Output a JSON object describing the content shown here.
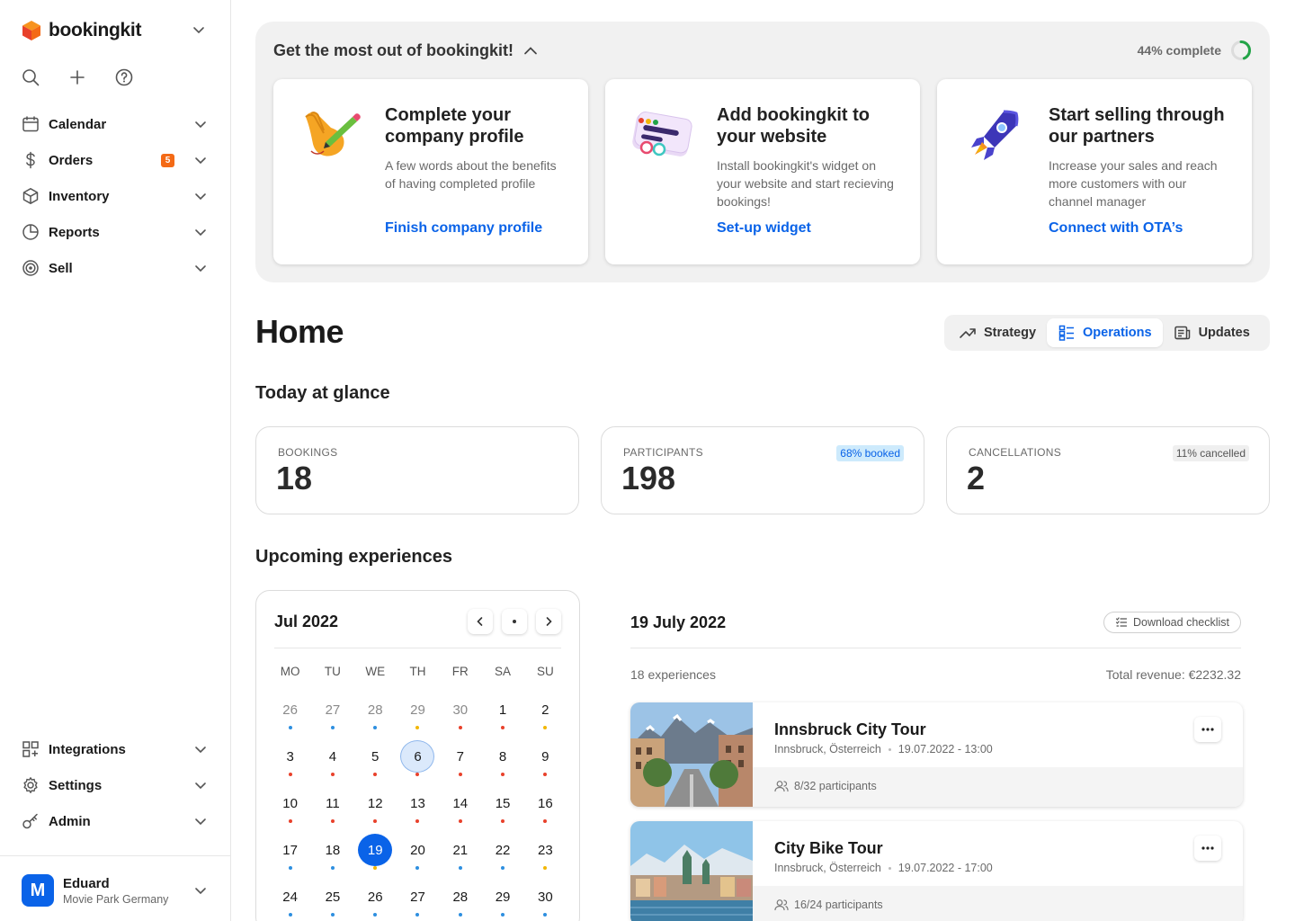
{
  "brand": {
    "name": "bookingkit"
  },
  "sidebar": {
    "items": [
      {
        "label": "Calendar",
        "icon": "calendar-icon"
      },
      {
        "label": "Orders",
        "icon": "dollar-icon",
        "badge": "5"
      },
      {
        "label": "Inventory",
        "icon": "box-icon"
      },
      {
        "label": "Reports",
        "icon": "pie-chart-icon"
      },
      {
        "label": "Sell",
        "icon": "target-icon"
      }
    ],
    "bottom_items": [
      {
        "label": "Integrations",
        "icon": "grid-plus-icon"
      },
      {
        "label": "Settings",
        "icon": "gear-icon"
      },
      {
        "label": "Admin",
        "icon": "key-icon"
      }
    ]
  },
  "user": {
    "initial": "M",
    "name": "Eduard",
    "org": "Movie Park Germany"
  },
  "onboarding": {
    "title": "Get the most out of bookingkit!",
    "progress_label": "44% complete",
    "progress": 0.44,
    "cards": [
      {
        "title": "Complete your company profile",
        "desc": "A few words about the benefits of having completed profile",
        "link": "Finish company profile"
      },
      {
        "title": "Add bookingkit to your website",
        "desc": "Install bookingkit's widget on your website and start recieving bookings!",
        "link": "Set-up widget"
      },
      {
        "title": "Start selling through our partners",
        "desc": "Increase your sales and reach more customers with our channel manager",
        "link": "Connect with OTA’s"
      }
    ]
  },
  "home": {
    "title": "Home",
    "tabs": [
      {
        "label": "Strategy",
        "active": false
      },
      {
        "label": "Operations",
        "active": true
      },
      {
        "label": "Updates",
        "active": false
      }
    ]
  },
  "glance": {
    "title": "Today at glance",
    "stats": [
      {
        "label": "BOOKINGS",
        "value": "18",
        "tag": ""
      },
      {
        "label": "PARTICIPANTS",
        "value": "198",
        "tag": "68% booked"
      },
      {
        "label": "CANCELLATIONS",
        "value": "2",
        "tag": "11% cancelled"
      }
    ]
  },
  "upcoming": {
    "title": "Upcoming experiences",
    "calendar": {
      "month": "Jul 2022",
      "weekdays": [
        "MO",
        "TU",
        "WE",
        "TH",
        "FR",
        "SA",
        "SU"
      ],
      "days": [
        {
          "n": "26",
          "muted": true,
          "dot": "#2d8fe0"
        },
        {
          "n": "27",
          "muted": true,
          "dot": "#2d8fe0"
        },
        {
          "n": "28",
          "muted": true,
          "dot": "#2d8fe0"
        },
        {
          "n": "29",
          "muted": true,
          "dot": "#f2b705"
        },
        {
          "n": "30",
          "muted": true,
          "dot": "#e8412b"
        },
        {
          "n": "1",
          "dot": "#e8412b"
        },
        {
          "n": "2",
          "dot": "#f2b705"
        },
        {
          "n": "3",
          "dot": "#e8412b"
        },
        {
          "n": "4",
          "dot": "#e8412b"
        },
        {
          "n": "5",
          "dot": "#e8412b"
        },
        {
          "n": "6",
          "dot": "#e8412b",
          "state": "sel-light"
        },
        {
          "n": "7",
          "dot": "#e8412b"
        },
        {
          "n": "8",
          "dot": "#e8412b"
        },
        {
          "n": "9",
          "dot": "#e8412b"
        },
        {
          "n": "10",
          "dot": "#e8412b"
        },
        {
          "n": "11",
          "dot": "#e8412b"
        },
        {
          "n": "12",
          "dot": "#e8412b"
        },
        {
          "n": "13",
          "dot": "#e8412b"
        },
        {
          "n": "14",
          "dot": "#e8412b"
        },
        {
          "n": "15",
          "dot": "#e8412b"
        },
        {
          "n": "16",
          "dot": "#e8412b"
        },
        {
          "n": "17",
          "dot": "#2d8fe0"
        },
        {
          "n": "18",
          "dot": "#2d8fe0"
        },
        {
          "n": "19",
          "dot": "#f2b705",
          "state": "sel"
        },
        {
          "n": "20",
          "dot": "#2d8fe0"
        },
        {
          "n": "21",
          "dot": "#2d8fe0"
        },
        {
          "n": "22",
          "dot": "#2d8fe0"
        },
        {
          "n": "23",
          "dot": "#f2b705"
        },
        {
          "n": "24",
          "dot": "#2d8fe0"
        },
        {
          "n": "25",
          "dot": "#2d8fe0"
        },
        {
          "n": "26",
          "dot": "#2d8fe0"
        },
        {
          "n": "27",
          "dot": "#2d8fe0"
        },
        {
          "n": "28",
          "dot": "#2d8fe0"
        },
        {
          "n": "29",
          "dot": "#2d8fe0"
        },
        {
          "n": "30",
          "dot": "#2d8fe0"
        }
      ]
    },
    "day": {
      "title": "19 July 2022",
      "download_label": "Download checklist",
      "count": "18 experiences",
      "revenue": "Total revenue: €2232.32",
      "experiences": [
        {
          "title": "Innsbruck City Tour",
          "location": "Innsbruck, Österreich",
          "datetime": "19.07.2022 - 13:00",
          "participants": "8/32 participants"
        },
        {
          "title": "City Bike Tour",
          "location": "Innsbruck, Österreich",
          "datetime": "19.07.2022 - 17:00",
          "participants": "16/24 participants"
        }
      ]
    }
  },
  "colors": {
    "accent": "#0a63e8",
    "badge": "#f46a16",
    "progress": "#22a447"
  }
}
